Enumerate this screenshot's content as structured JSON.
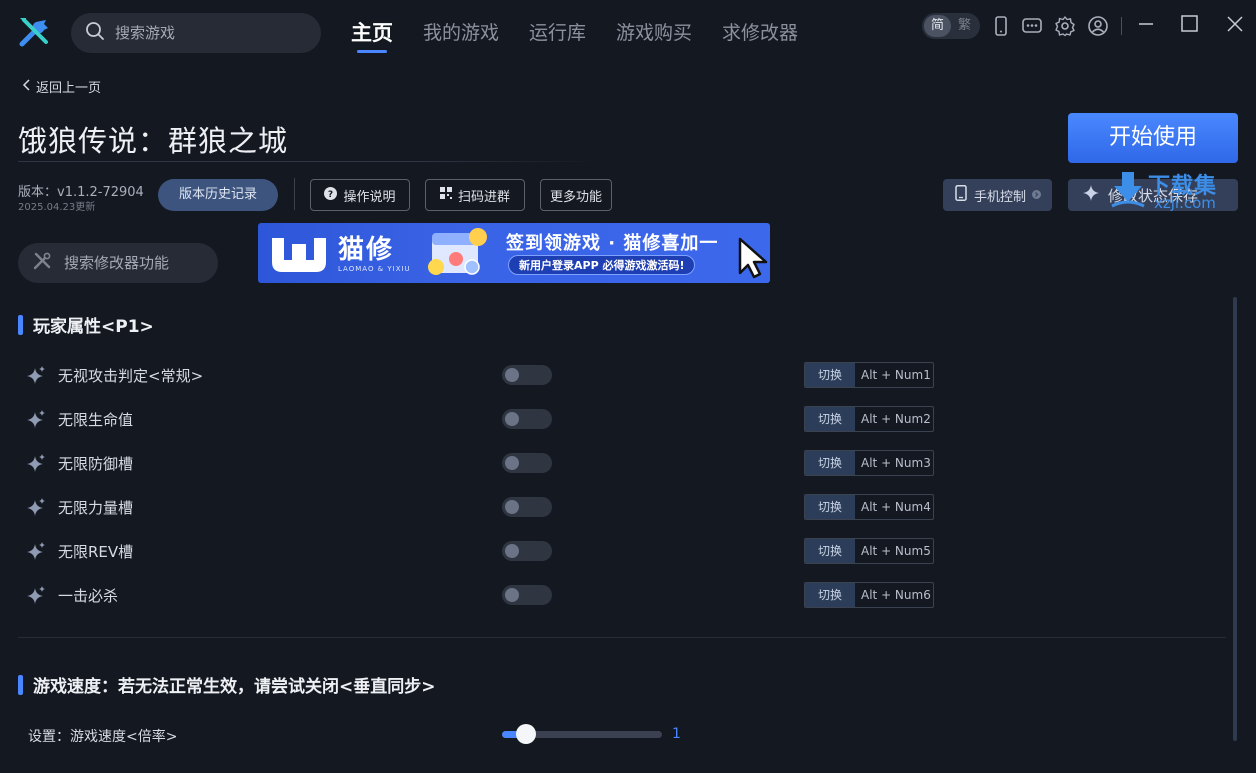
{
  "topbar": {
    "search_placeholder": "搜索游戏",
    "tabs": [
      {
        "label": "主页"
      },
      {
        "label": "我的游戏"
      },
      {
        "label": "运行库"
      },
      {
        "label": "游戏购买"
      },
      {
        "label": "求修改器"
      }
    ],
    "lang": {
      "simplified": "简",
      "traditional": "繁"
    }
  },
  "header": {
    "back_label": "返回上一页",
    "game_title": "饿狼传说：群狼之城",
    "start_label": "开始使用",
    "version": "版本：v1.1.2-72904",
    "version_date": "2025.04.23更新",
    "history_label": "版本历史记录",
    "manual_label": "操作说明",
    "scan_label": "扫码进群",
    "more_label": "更多功能",
    "phone_ctrl_label": "手机控制",
    "save_state_label": "修改状态保存"
  },
  "watermark": {
    "text": "下载集",
    "sub": "xzji.com"
  },
  "feature_search_placeholder": "搜索修改器功能",
  "banner": {
    "brand": "猫修",
    "brand_sub": "LAOMAO & YIXIU",
    "headline": "签到领游戏 · 猫修喜加一",
    "pill": "新用户登录APP  必得游戏激活码!"
  },
  "sections": {
    "player": {
      "title": "玩家属性<P1>",
      "action_label": "切换",
      "rows": [
        {
          "label": "无视攻击判定<常规>",
          "hotkey": "Alt + Num1"
        },
        {
          "label": "无限生命值",
          "hotkey": "Alt + Num2"
        },
        {
          "label": "无限防御槽",
          "hotkey": "Alt + Num3"
        },
        {
          "label": "无限力量槽",
          "hotkey": "Alt + Num4"
        },
        {
          "label": "无限REV槽",
          "hotkey": "Alt + Num5"
        },
        {
          "label": "一击必杀",
          "hotkey": "Alt + Num6"
        }
      ]
    },
    "speed": {
      "title": "游戏速度：若无法正常生效，请尝试关闭<垂直同步>",
      "slider_label": "设置：游戏速度<倍率>",
      "slider_value": "1"
    }
  },
  "colors": {
    "accent": "#4a86ff",
    "background": "#141821"
  }
}
